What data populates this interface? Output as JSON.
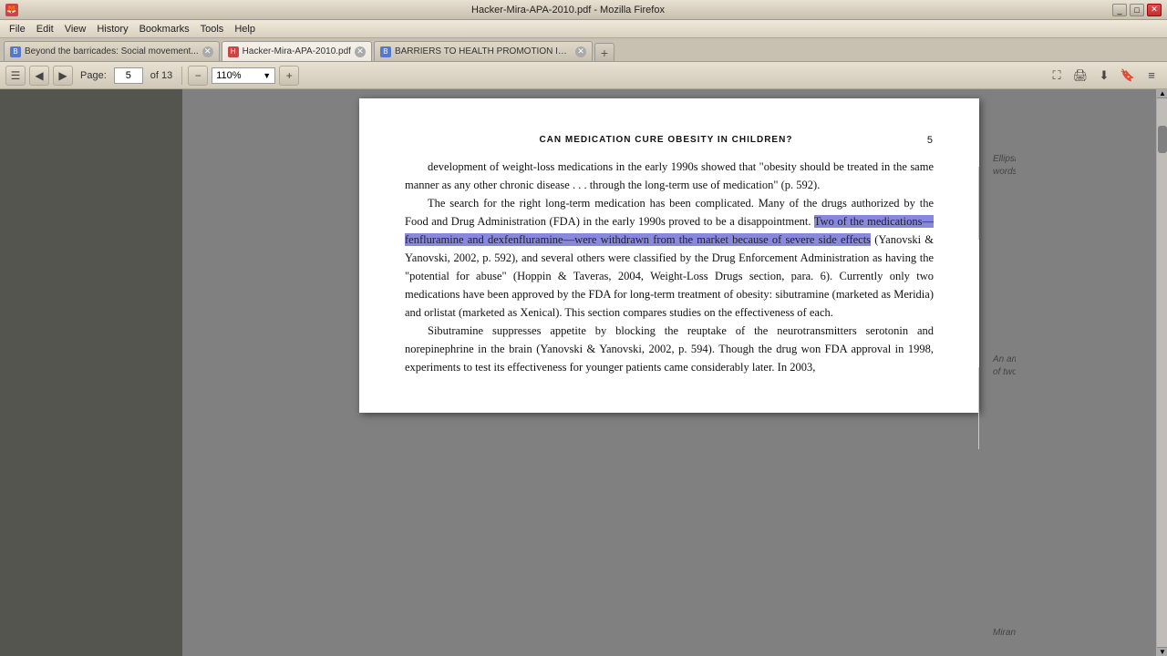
{
  "titleBar": {
    "icon": "🦊",
    "title": "Hacker-Mira-APA-2010.pdf - Mozilla Firefox",
    "buttons": [
      "_",
      "□",
      "✕"
    ]
  },
  "menuBar": {
    "items": [
      "File",
      "Edit",
      "View",
      "History",
      "Bookmarks",
      "Tools",
      "Help"
    ]
  },
  "tabs": [
    {
      "id": "tab1",
      "favicon": "B",
      "title": "Beyond the barricades: Social movement...",
      "active": false,
      "closeable": true
    },
    {
      "id": "tab2",
      "favicon": "H",
      "title": "Hacker-Mira-APA-2010.pdf",
      "active": true,
      "closeable": true
    },
    {
      "id": "tab3",
      "favicon": "B",
      "title": "BARRIERS TO HEALTH PROMOTION IN A...",
      "active": false,
      "closeable": true
    }
  ],
  "toolbar": {
    "nav_prev": "◀",
    "nav_next": "▶",
    "page_label": "Page:",
    "page_current": "5",
    "page_of": "of 13",
    "zoom_out": "−",
    "zoom_in": "+",
    "zoom_level": "110%",
    "icons": {
      "fullscreen": "⛶",
      "print": "🖨",
      "download": "⬇",
      "bookmark": "🔖",
      "menu": "≡"
    }
  },
  "content": {
    "pageTitle": "CAN MEDICATION CURE OBESITY IN CHILDREN?",
    "paragraphs": [
      {
        "indent": true,
        "text": "development of weight-loss medications in the early 1990s showed that \"obesity should be treated in the same manner as any other chronic disease . . . through the long-term use of medication\" (p. 592)."
      },
      {
        "indent": true,
        "text": "The search for the right long-term medication has been complicated. Many of the drugs authorized by the Food and Drug Administration (FDA) in the early 1990s proved to be a disappointment. "
      },
      {
        "inline_highlight": "Two of the medications—fenfluramine and dexfenfluramine—were withdrawn from the market because of severe side effects",
        "after_highlight": " (Yanovski & Yanovski, 2002, p. 592), and several others were classified by the Drug Enforcement Administration as having the \"potential for abuse\" (Hoppin & Taveras, 2004, Weight-Loss Drugs section, para. 6). Currently only two medications have been approved by the FDA for long-term treatment of obesity: sibutramine (marketed as Meridia) and orlistat (marketed as Xenical). This section compares studies on the effectiveness of each."
      },
      {
        "indent": true,
        "text": "Sibutramine suppresses appetite by blocking the reuptake of the neurotransmitters serotonin and norepinephrine in the brain (Yanovski & Yanovski, 2002, p. 594). Though the drug won FDA approval in 1998, experiments to test its effectiveness for younger patients came considerably later. In 2003,"
      }
    ],
    "annotations": [
      {
        "id": "ann1",
        "text": "Ellipsis mark indicates omitted words.",
        "topPercent": 21
      },
      {
        "id": "ann2",
        "text": "An ampersand links the names of two authors in parentheses.",
        "topPercent": 52
      },
      {
        "id": "ann3",
        "text": "Mirano draws",
        "topPercent": 92
      }
    ]
  }
}
